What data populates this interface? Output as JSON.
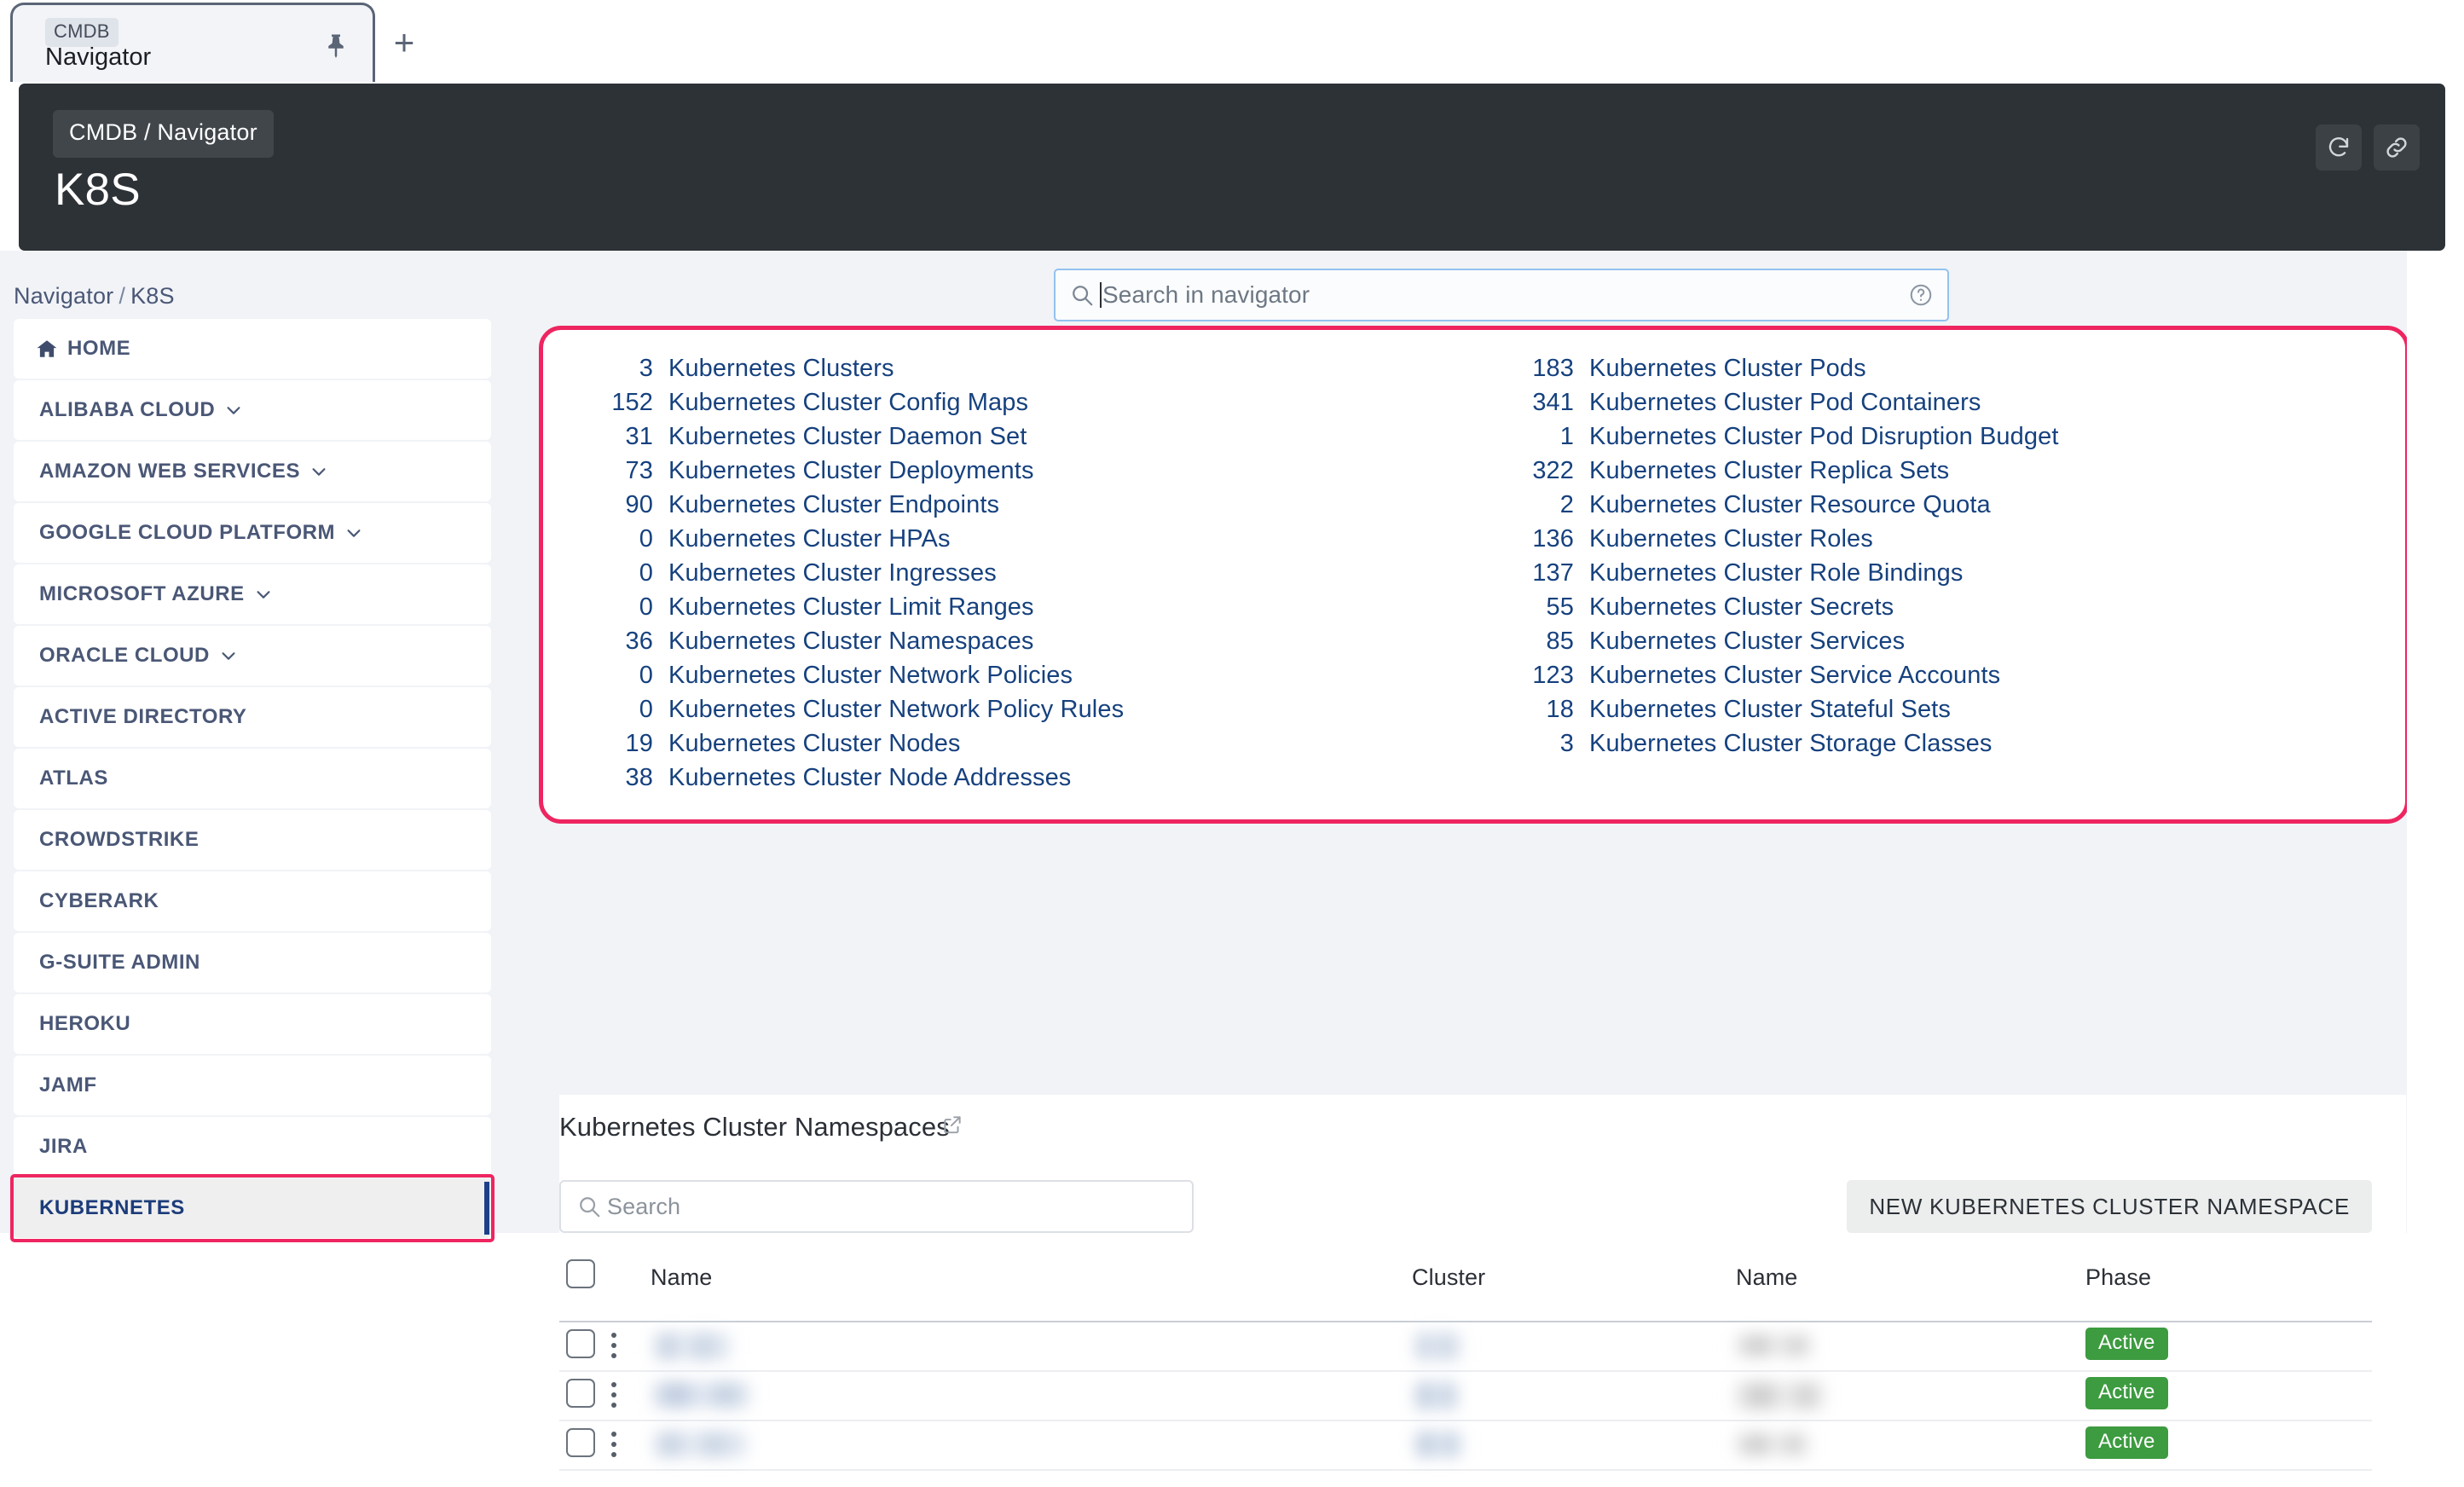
{
  "tab": {
    "badge": "CMDB",
    "title": "Navigator",
    "pin_icon": "pin-icon",
    "new_tab_label": "+"
  },
  "header": {
    "breadcrumb_chip": "CMDB / Navigator",
    "title": "K8S",
    "actions": [
      {
        "name": "refresh-icon",
        "label": "Refresh"
      },
      {
        "name": "link-icon",
        "label": "Copy link"
      }
    ]
  },
  "breadcrumb": {
    "root": "Navigator",
    "separator": "/",
    "current": "K8S"
  },
  "navigator_search": {
    "placeholder": "Search in navigator",
    "value": "",
    "search_icon": "search-icon",
    "help_icon": "question-circle-icon"
  },
  "sidebar": {
    "items": [
      {
        "label": "HOME",
        "icon": "home-icon",
        "expandable": false,
        "active": false
      },
      {
        "label": "ALIBABA CLOUD",
        "expandable": true,
        "active": false
      },
      {
        "label": "AMAZON WEB SERVICES",
        "expandable": true,
        "active": false
      },
      {
        "label": "GOOGLE CLOUD PLATFORM",
        "expandable": true,
        "active": false
      },
      {
        "label": "MICROSOFT AZURE",
        "expandable": true,
        "active": false
      },
      {
        "label": "ORACLE CLOUD",
        "expandable": true,
        "active": false
      },
      {
        "label": "ACTIVE DIRECTORY",
        "expandable": false,
        "active": false
      },
      {
        "label": "ATLAS",
        "expandable": false,
        "active": false
      },
      {
        "label": "CROWDSTRIKE",
        "expandable": false,
        "active": false
      },
      {
        "label": "CYBERARK",
        "expandable": false,
        "active": false
      },
      {
        "label": "G-SUITE ADMIN",
        "expandable": false,
        "active": false
      },
      {
        "label": "HEROKU",
        "expandable": false,
        "active": false
      },
      {
        "label": "JAMF",
        "expandable": false,
        "active": false
      },
      {
        "label": "JIRA",
        "expandable": false,
        "active": false
      },
      {
        "label": "KUBERNETES",
        "expandable": false,
        "active": true
      }
    ]
  },
  "stats": {
    "left_column": [
      {
        "count": "3",
        "label": "Kubernetes Clusters"
      },
      {
        "count": "152",
        "label": "Kubernetes Cluster Config Maps"
      },
      {
        "count": "31",
        "label": "Kubernetes Cluster Daemon Set"
      },
      {
        "count": "73",
        "label": "Kubernetes Cluster Deployments"
      },
      {
        "count": "90",
        "label": "Kubernetes Cluster Endpoints"
      },
      {
        "count": "0",
        "label": "Kubernetes Cluster HPAs"
      },
      {
        "count": "0",
        "label": "Kubernetes Cluster Ingresses"
      },
      {
        "count": "0",
        "label": "Kubernetes Cluster Limit Ranges"
      },
      {
        "count": "36",
        "label": "Kubernetes Cluster Namespaces"
      },
      {
        "count": "0",
        "label": "Kubernetes Cluster Network Policies"
      },
      {
        "count": "0",
        "label": "Kubernetes Cluster Network Policy Rules"
      },
      {
        "count": "19",
        "label": "Kubernetes Cluster Nodes"
      },
      {
        "count": "38",
        "label": "Kubernetes Cluster Node Addresses"
      }
    ],
    "right_column": [
      {
        "count": "183",
        "label": "Kubernetes Cluster Pods"
      },
      {
        "count": "341",
        "label": "Kubernetes Cluster Pod Containers"
      },
      {
        "count": "1",
        "label": "Kubernetes Cluster Pod Disruption Budget"
      },
      {
        "count": "322",
        "label": "Kubernetes Cluster Replica Sets"
      },
      {
        "count": "2",
        "label": "Kubernetes Cluster Resource Quota"
      },
      {
        "count": "136",
        "label": "Kubernetes Cluster Roles"
      },
      {
        "count": "137",
        "label": "Kubernetes Cluster Role Bindings"
      },
      {
        "count": "55",
        "label": "Kubernetes Cluster Secrets"
      },
      {
        "count": "85",
        "label": "Kubernetes Cluster Services"
      },
      {
        "count": "123",
        "label": "Kubernetes Cluster Service Accounts"
      },
      {
        "count": "18",
        "label": "Kubernetes Cluster Stateful Sets"
      },
      {
        "count": "3",
        "label": "Kubernetes Cluster Storage Classes"
      }
    ]
  },
  "table_section": {
    "title": "Kubernetes Cluster Namespaces",
    "external_link_icon": "external-link-icon",
    "search": {
      "placeholder": "Search",
      "value": "",
      "icon": "search-icon"
    },
    "new_button": "NEW KUBERNETES CLUSTER NAMESPACE",
    "columns": [
      "Name",
      "Cluster",
      "Name",
      "Phase"
    ],
    "rows": [
      {
        "name": "",
        "cluster": "",
        "name2": "",
        "phase": "Active"
      },
      {
        "name": "",
        "cluster": "",
        "name2": "",
        "phase": "Active"
      },
      {
        "name": "",
        "cluster": "",
        "name2": "",
        "phase": "Active"
      }
    ]
  },
  "colors": {
    "header_dark": "#2d3237",
    "link_blue": "#16417e",
    "annotation_pink": "#ee2560",
    "badge_green": "#3d9b40",
    "page_bg": "#f1f3f7",
    "sidebar_active_bg": "#efefef",
    "sidebar_active_text": "#1c3c7a"
  }
}
